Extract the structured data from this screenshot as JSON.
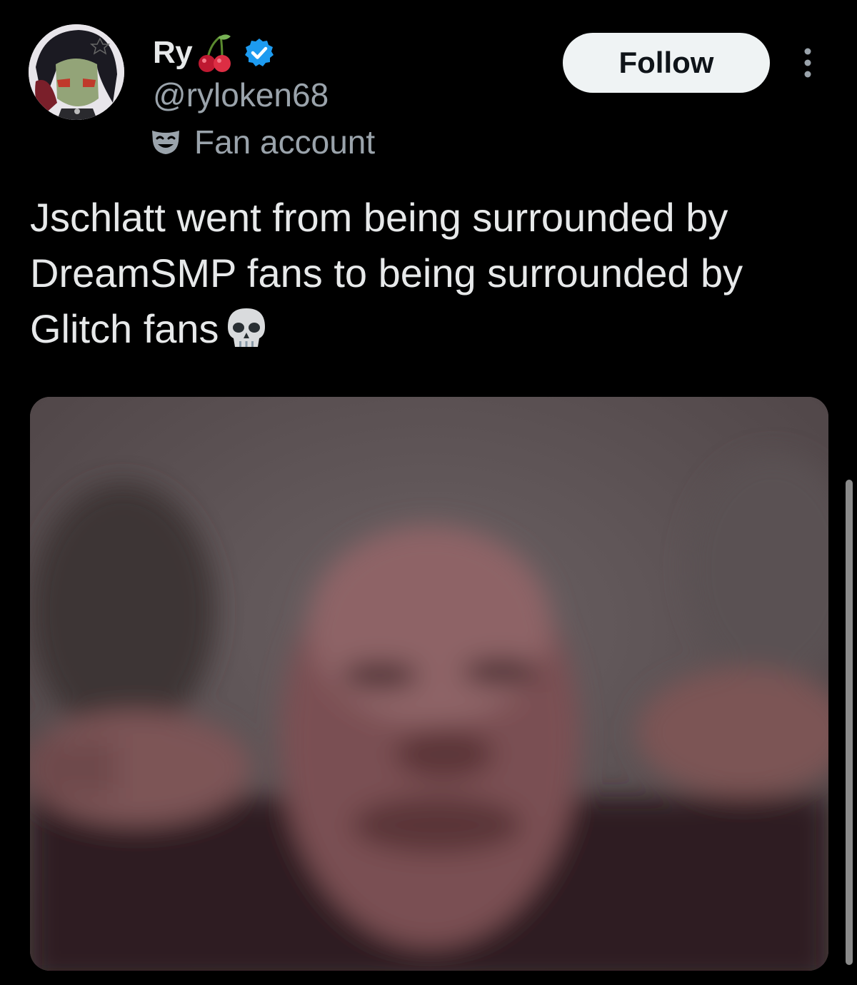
{
  "author": {
    "display_name": "Ry",
    "name_emoji": "cherry-emoji",
    "verified": true,
    "handle": "@ryloken68",
    "profile_label": "Fan account",
    "profile_label_icon": "theater-mask-icon"
  },
  "actions": {
    "follow_label": "Follow"
  },
  "tweet": {
    "text": "Jschlatt went from being surrounded by DreamSMP fans to being surrounded by Glitch fans",
    "trailing_emoji": "skull-emoji"
  },
  "colors": {
    "background": "#000000",
    "primary_text": "#e7e9ea",
    "secondary_text": "#9aa3ab",
    "verified_blue": "#1d9bf0",
    "follow_bg": "#eff3f4"
  }
}
